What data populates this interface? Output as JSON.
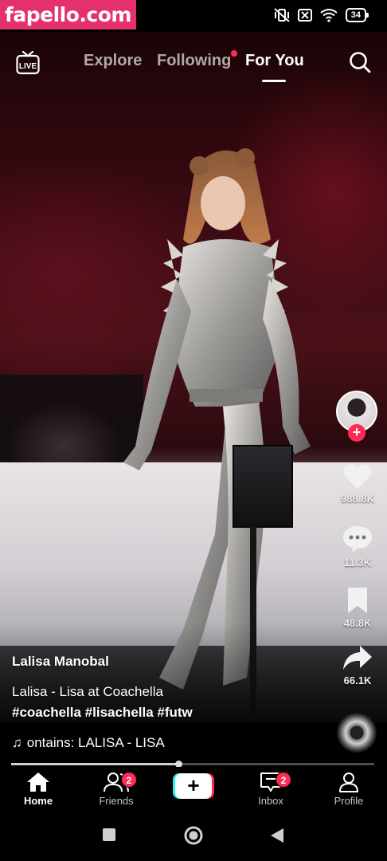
{
  "watermark": "fapello.com",
  "status": {
    "battery": "34"
  },
  "top_nav": {
    "tabs": [
      {
        "label": "Explore"
      },
      {
        "label": "Following"
      },
      {
        "label": "For You"
      }
    ],
    "active_tab": "For You"
  },
  "video": {
    "author": "Lalisa Manobal",
    "description": "Lalisa - Lisa at Coachella",
    "hashtags": "#coachella #lisachella #futw",
    "music": "ontains: LALISA - LISA",
    "progress": 0.46
  },
  "actions": {
    "likes": "988.8K",
    "comments": "11.3K",
    "saves": "48.8K",
    "shares": "66.1K"
  },
  "bottom_nav": {
    "home": "Home",
    "friends": "Friends",
    "friends_badge": "2",
    "create": "+",
    "inbox": "Inbox",
    "inbox_badge": "2",
    "profile": "Profile"
  },
  "colors": {
    "accent": "#fe2c55",
    "cyan": "#25f4ee",
    "watermark_bg": "#e4306b"
  }
}
